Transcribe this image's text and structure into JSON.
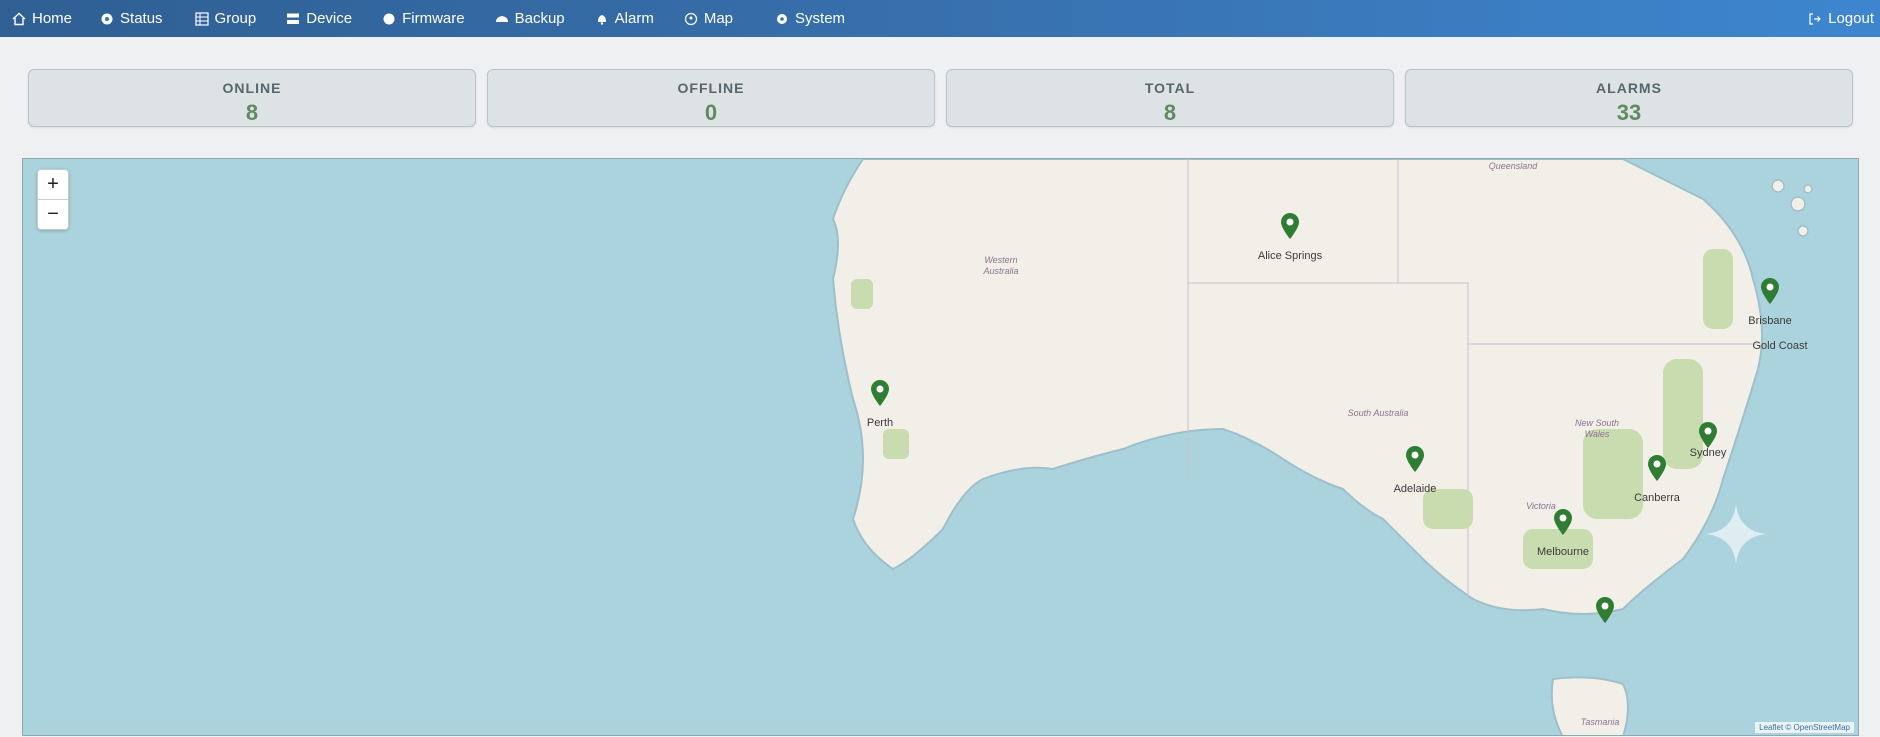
{
  "nav": {
    "items": [
      {
        "label": "Home",
        "icon": "home-icon"
      },
      {
        "label": "Status",
        "icon": "status-icon"
      },
      {
        "label": "Group",
        "icon": "group-icon"
      },
      {
        "label": "Device",
        "icon": "device-icon"
      },
      {
        "label": "Firmware",
        "icon": "firmware-icon"
      },
      {
        "label": "Backup",
        "icon": "backup-icon"
      },
      {
        "label": "Alarm",
        "icon": "bell-icon"
      },
      {
        "label": "Map",
        "icon": "map-pin-icon"
      },
      {
        "label": "System",
        "icon": "gear-icon"
      }
    ],
    "logout_label": "Logout"
  },
  "stats": [
    {
      "title": "ONLINE",
      "value": "8"
    },
    {
      "title": "OFFLINE",
      "value": "0"
    },
    {
      "title": "TOTAL",
      "value": "8"
    },
    {
      "title": "ALARMS",
      "value": "33"
    }
  ],
  "map": {
    "zoom_in": "+",
    "zoom_out": "−",
    "regions": [
      {
        "label": "Queensland"
      },
      {
        "label": "Western Australia"
      },
      {
        "label": "South Australia"
      },
      {
        "label": "New South Wales"
      },
      {
        "label": "Victoria"
      },
      {
        "label": "Tasmania"
      }
    ],
    "markers": [
      {
        "city": "Alice Springs"
      },
      {
        "city": "Brisbane"
      },
      {
        "city": "Gold Coast"
      },
      {
        "city": "Perth"
      },
      {
        "city": "Sydney"
      },
      {
        "city": "Adelaide"
      },
      {
        "city": "Canberra"
      },
      {
        "city": "Melbourne"
      },
      {
        "city": ""
      }
    ],
    "attribution": "Leaflet © OpenStreetMap",
    "colors": {
      "water": "#abd3dd",
      "land": "#f2efe8",
      "park": "#c8dcb0",
      "marker": "#2e7d32"
    }
  }
}
